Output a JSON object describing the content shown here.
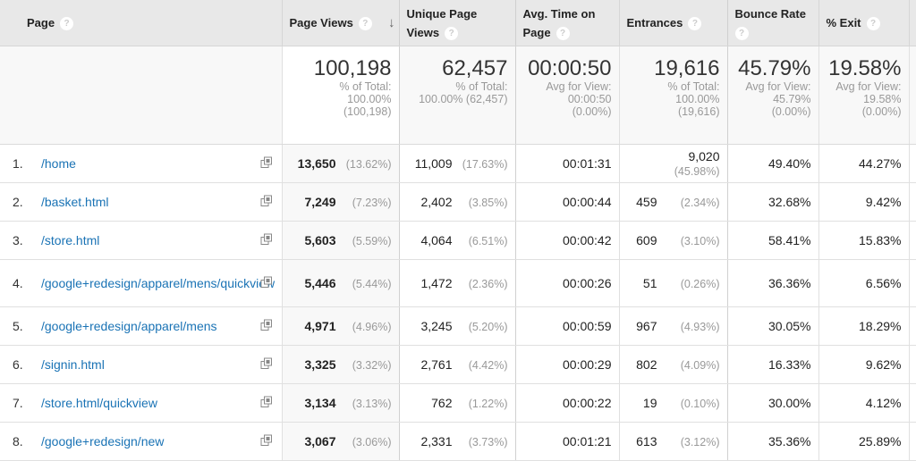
{
  "columns": {
    "page": "Page",
    "page_views": "Page Views",
    "unique_page_views": "Unique Page Views",
    "avg_time": "Avg. Time on Page",
    "entrances": "Entrances",
    "bounce_rate": "Bounce Rate",
    "exit": "% Exit",
    "help_glyph": "?",
    "sort_glyph": "↓"
  },
  "summary": {
    "page_views": {
      "value": "100,198",
      "l1": "% of Total:",
      "l2": "100.00%",
      "l3": "(100,198)"
    },
    "unique_page_views": {
      "value": "62,457",
      "l1": "% of Total:",
      "l2": "100.00% (62,457)"
    },
    "avg_time": {
      "value": "00:00:50",
      "l1": "Avg for View:",
      "l2": "00:00:50",
      "l3": "(0.00%)"
    },
    "entrances": {
      "value": "19,616",
      "l1": "% of Total:",
      "l2": "100.00%",
      "l3": "(19,616)"
    },
    "bounce_rate": {
      "value": "45.79%",
      "l1": "Avg for View:",
      "l2": "45.79%",
      "l3": "(0.00%)"
    },
    "exit": {
      "value": "19.58%",
      "l1": "Avg for View:",
      "l2": "19.58%",
      "l3": "(0.00%)"
    }
  },
  "rows": [
    {
      "idx": "1.",
      "page": "/home",
      "pv": "13,650",
      "pv_pct": "(13.62%)",
      "upv": "11,009",
      "upv_pct": "(17.63%)",
      "avg": "00:01:31",
      "ent": "9,020",
      "ent_pct": "(45.98%)",
      "br": "49.40%",
      "ex": "44.27%"
    },
    {
      "idx": "2.",
      "page": "/basket.html",
      "pv": "7,249",
      "pv_pct": "(7.23%)",
      "upv": "2,402",
      "upv_pct": "(3.85%)",
      "avg": "00:00:44",
      "ent": "459",
      "ent_pct": "(2.34%)",
      "br": "32.68%",
      "ex": "9.42%"
    },
    {
      "idx": "3.",
      "page": "/store.html",
      "pv": "5,603",
      "pv_pct": "(5.59%)",
      "upv": "4,064",
      "upv_pct": "(6.51%)",
      "avg": "00:00:42",
      "ent": "609",
      "ent_pct": "(3.10%)",
      "br": "58.41%",
      "ex": "15.83%"
    },
    {
      "idx": "4.",
      "page": "/google+redesign/apparel/mens/quickview",
      "pv": "5,446",
      "pv_pct": "(5.44%)",
      "upv": "1,472",
      "upv_pct": "(2.36%)",
      "avg": "00:00:26",
      "ent": "51",
      "ent_pct": "(0.26%)",
      "br": "36.36%",
      "ex": "6.56%"
    },
    {
      "idx": "5.",
      "page": "/google+redesign/apparel/mens",
      "pv": "4,971",
      "pv_pct": "(4.96%)",
      "upv": "3,245",
      "upv_pct": "(5.20%)",
      "avg": "00:00:59",
      "ent": "967",
      "ent_pct": "(4.93%)",
      "br": "30.05%",
      "ex": "18.29%"
    },
    {
      "idx": "6.",
      "page": "/signin.html",
      "pv": "3,325",
      "pv_pct": "(3.32%)",
      "upv": "2,761",
      "upv_pct": "(4.42%)",
      "avg": "00:00:29",
      "ent": "802",
      "ent_pct": "(4.09%)",
      "br": "16.33%",
      "ex": "9.62%"
    },
    {
      "idx": "7.",
      "page": "/store.html/quickview",
      "pv": "3,134",
      "pv_pct": "(3.13%)",
      "upv": "762",
      "upv_pct": "(1.22%)",
      "avg": "00:00:22",
      "ent": "19",
      "ent_pct": "(0.10%)",
      "br": "30.00%",
      "ex": "4.12%"
    },
    {
      "idx": "8.",
      "page": "/google+redesign/new",
      "pv": "3,067",
      "pv_pct": "(3.06%)",
      "upv": "2,331",
      "upv_pct": "(3.73%)",
      "avg": "00:01:21",
      "ent": "613",
      "ent_pct": "(3.12%)",
      "br": "35.36%",
      "ex": "25.89%"
    }
  ],
  "colors": {
    "link": "#1a73b5",
    "header_bg": "#e8e8e8",
    "sorted_col_bg": "#f8f8f8"
  }
}
